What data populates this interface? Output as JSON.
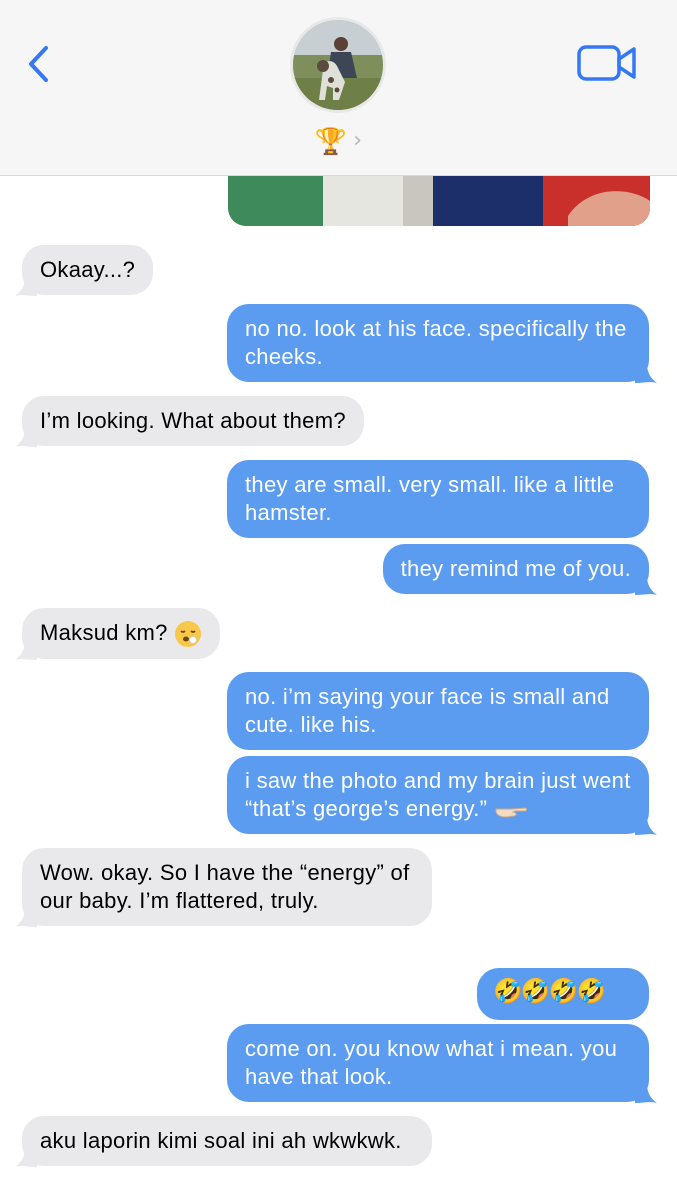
{
  "header": {
    "contact_emoji": "🏆",
    "contact_chevron": "›",
    "back_icon": "chevron-left-icon",
    "video_icon": "video-camera-icon"
  },
  "colors": {
    "outgoing": "#5b9cf1",
    "incoming": "#e9e9eb",
    "accent": "#3478f6"
  },
  "messages": [
    {
      "dir": "in",
      "text": "Okaay...?"
    },
    {
      "dir": "out",
      "text": "no no. look at his face. specifically the cheeks."
    },
    {
      "dir": "in",
      "text": "I’m looking. What about them?"
    },
    {
      "dir": "out",
      "text": "they are small. very small. like a little hamster."
    },
    {
      "dir": "out",
      "text": "they remind me of you."
    },
    {
      "dir": "in",
      "text": "Maksud km?"
    },
    {
      "dir": "out",
      "text": "no. i’m saying your face is small and cute. like his."
    },
    {
      "dir": "out",
      "text": "i saw the photo and my brain just went “that’s george’s energy.”"
    },
    {
      "dir": "in",
      "text": "Wow. okay. So I have the “energy” of our baby. I’m flattered, truly."
    },
    {
      "dir": "out",
      "text": "🤣🤣🤣🤣"
    },
    {
      "dir": "out",
      "text": "come on. you know what i mean. you have that look."
    },
    {
      "dir": "in",
      "text": "aku laporin kimi soal ini ah wkwkwk."
    }
  ]
}
